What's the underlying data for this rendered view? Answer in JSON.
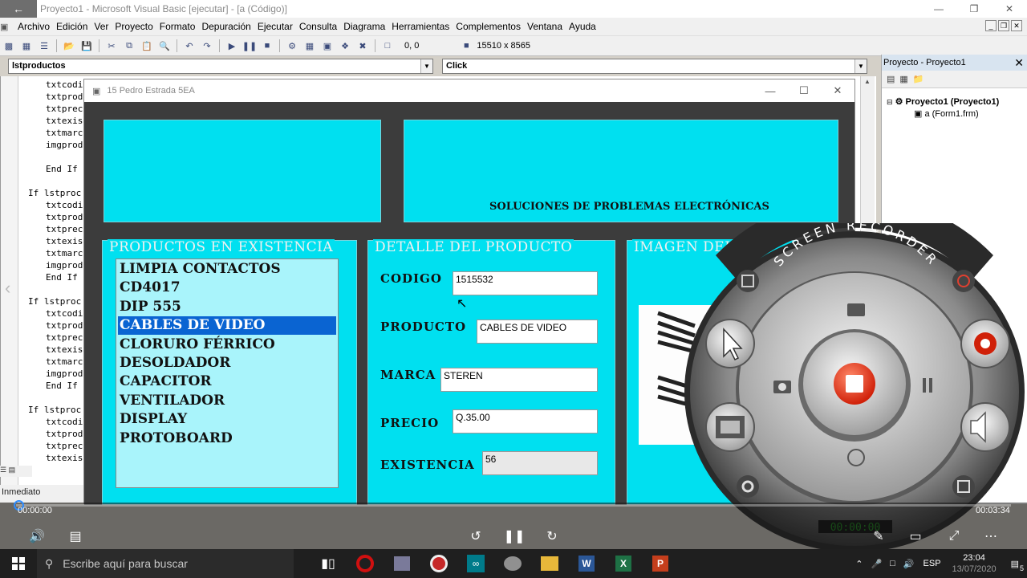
{
  "ide": {
    "window_title": "Proyecto1 - Microsoft Visual Basic [ejecutar] - [a (Código)]",
    "menu": [
      "Archivo",
      "Edición",
      "Ver",
      "Proyecto",
      "Formato",
      "Depuración",
      "Ejecutar",
      "Consulta",
      "Diagrama",
      "Herramientas",
      "Complementos",
      "Ventana",
      "Ayuda"
    ],
    "toolbar": {
      "position": "0, 0",
      "size": "15510 x 8565"
    },
    "object_combo": "lstproductos",
    "proc_combo": "Click",
    "code_lines": [
      "txtcodi",
      "txtprod",
      "txtprec",
      "txtexis",
      "txtmarc",
      "imgprod",
      "",
      "End If",
      "",
      "If lstproc",
      "txtcodi",
      "txtprod",
      "txtprec",
      "txtexis",
      "txtmarc",
      "imgprod",
      "End If",
      "",
      "If lstproc",
      "txtcodi",
      "txtprod",
      "txtprec",
      "txtexis",
      "txtmarc",
      "imgprod",
      "End If",
      "",
      "If lstproc",
      "txtcodi",
      "txtprod",
      "txtprec",
      "txtexis"
    ],
    "immediate_label": "Inmediato"
  },
  "project": {
    "title": "Proyecto - Proyecto1",
    "root": "Proyecto1 (Proyecto1)",
    "form": "a (Form1.frm)"
  },
  "form": {
    "title": "15 Pedro Estrada 5EA",
    "banner": "SOLUCIONES DE PROBLEMAS ELECTRÓNICAS",
    "frame_products": "PRODUCTOS EN EXISTENCIA",
    "frame_detail": "DETALLE DEL PRODUCTO",
    "frame_image": "IMAGEN DEL PRO",
    "products": [
      "LIMPIA CONTACTOS",
      "CD4017",
      "DIP 555",
      "CABLES DE VIDEO",
      "CLORURO FÉRRICO",
      "DESOLDADOR",
      "CAPACITOR",
      "VENTILADOR",
      "DISPLAY",
      "PROTOBOARD"
    ],
    "selected_index": 3,
    "fields": {
      "codigo_label": "CODIGO",
      "codigo": "1515532",
      "producto_label": "PRODUCTO",
      "producto": "CABLES DE VIDEO",
      "marca_label": "MARCA",
      "marca": "STEREN",
      "precio_label": "PRECIO",
      "precio": "Q.35.00",
      "existencia_label": "EXISTENCIA",
      "existencia": "56"
    }
  },
  "recorder": {
    "title": "SCREEN RECORDER",
    "timer": "00:00:00"
  },
  "video": {
    "current_time": "00:00:00",
    "duration": "00:03:34",
    "progress": 0.0
  },
  "taskbar": {
    "search_placeholder": "Escribe aquí para buscar",
    "language": "ESP",
    "time": "23:04",
    "date": "13/07/2020",
    "notifications": "5"
  },
  "colors": {
    "form_cyan": "#00e0f0",
    "list_bg": "#a9f4fb",
    "selection": "#0a64d2",
    "form_dark": "#3c3c3c"
  }
}
